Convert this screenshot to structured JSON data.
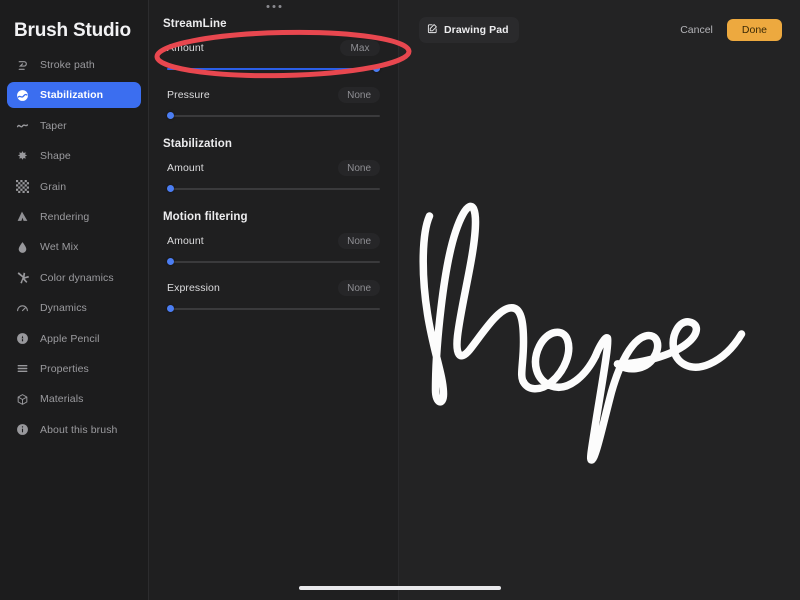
{
  "app": {
    "title": "Brush Studio"
  },
  "sidebar": {
    "items": [
      {
        "label": "Stroke path",
        "icon": "stroke-path-icon",
        "active": false
      },
      {
        "label": "Stabilization",
        "icon": "stabilization-icon",
        "active": true
      },
      {
        "label": "Taper",
        "icon": "taper-icon",
        "active": false
      },
      {
        "label": "Shape",
        "icon": "shape-icon",
        "active": false
      },
      {
        "label": "Grain",
        "icon": "grain-icon",
        "active": false
      },
      {
        "label": "Rendering",
        "icon": "rendering-icon",
        "active": false
      },
      {
        "label": "Wet Mix",
        "icon": "wet-mix-icon",
        "active": false
      },
      {
        "label": "Color dynamics",
        "icon": "color-dynamics-icon",
        "active": false
      },
      {
        "label": "Dynamics",
        "icon": "dynamics-icon",
        "active": false
      },
      {
        "label": "Apple Pencil",
        "icon": "apple-pencil-icon",
        "active": false
      },
      {
        "label": "Properties",
        "icon": "properties-icon",
        "active": false
      },
      {
        "label": "Materials",
        "icon": "materials-icon",
        "active": false
      },
      {
        "label": "About this brush",
        "icon": "info-icon",
        "active": false
      }
    ]
  },
  "settings": {
    "sections": [
      {
        "title": "StreamLine",
        "controls": [
          {
            "label": "Amount",
            "value": "Max",
            "fill": 100
          },
          {
            "label": "Pressure",
            "value": "None",
            "fill": 0
          }
        ]
      },
      {
        "title": "Stabilization",
        "controls": [
          {
            "label": "Amount",
            "value": "None",
            "fill": 0
          }
        ]
      },
      {
        "title": "Motion filtering",
        "controls": [
          {
            "label": "Amount",
            "value": "None",
            "fill": 0
          },
          {
            "label": "Expression",
            "value": "None",
            "fill": 0
          }
        ]
      }
    ]
  },
  "pad": {
    "title": "Drawing Pad",
    "title_icon": "edit-pencil-icon",
    "cancel_label": "Cancel",
    "done_label": "Done",
    "sketch_text": "hope"
  },
  "annotation": {
    "shape": "red-ellipse-highlight",
    "color": "#e8474f",
    "target": "StreamLine Amount slider"
  },
  "colors": {
    "accent_blue": "#3b6ef0",
    "done_orange": "#eda93f",
    "annotation_red": "#e8474f",
    "panel_bg": "#1f1f20",
    "sidebar_bg": "#1c1c1d",
    "canvas_bg": "#232324"
  }
}
